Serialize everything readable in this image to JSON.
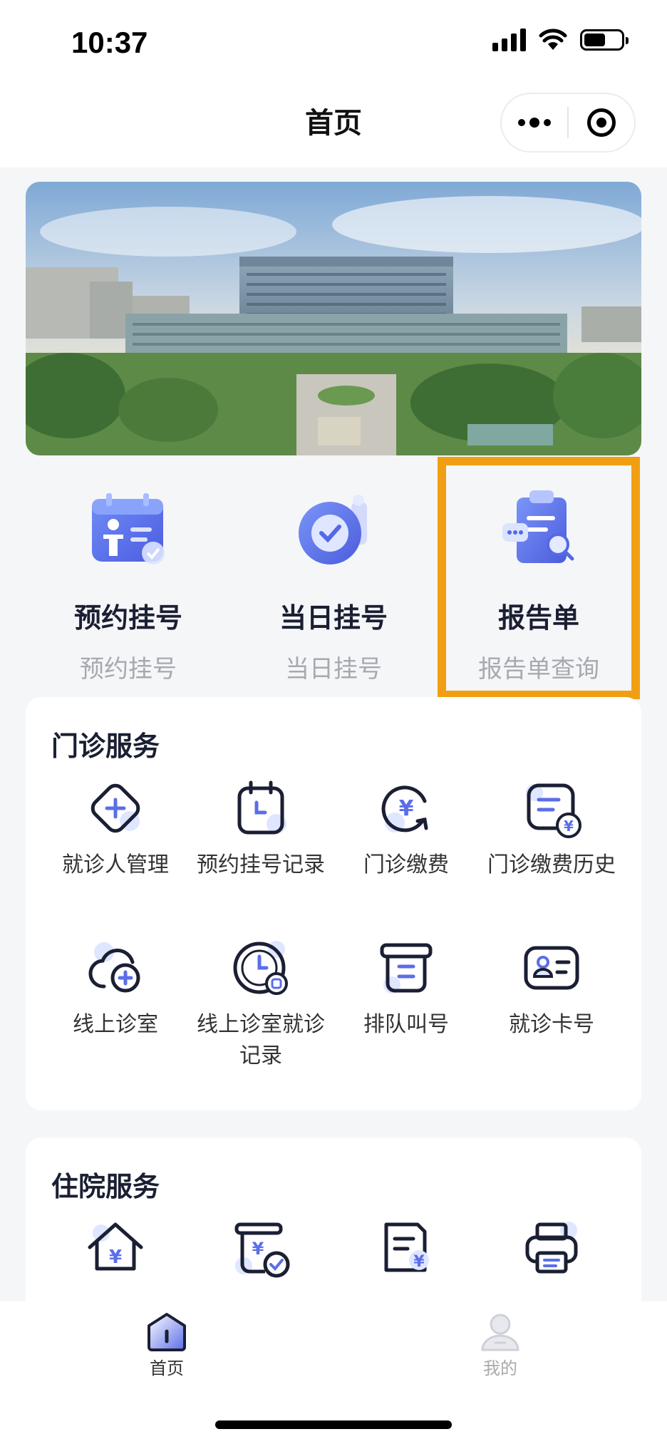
{
  "status_bar": {
    "time": "10:37"
  },
  "nav": {
    "title": "首页"
  },
  "quick_actions": [
    {
      "title": "预约挂号",
      "subtitle": "预约挂号",
      "icon": "calendar-person-icon"
    },
    {
      "title": "当日挂号",
      "subtitle": "当日挂号",
      "icon": "check-badge-icon"
    },
    {
      "title": "报告单",
      "subtitle": "报告单查询",
      "icon": "report-clipboard-icon"
    }
  ],
  "outpatient": {
    "title": "门诊服务",
    "items": [
      {
        "label": "就诊人管理",
        "icon": "plus-diamond-icon"
      },
      {
        "label": "预约挂号记录",
        "icon": "calendar-clock-icon"
      },
      {
        "label": "门诊缴费",
        "icon": "yuan-refresh-icon"
      },
      {
        "label": "门诊缴费历史",
        "icon": "bill-history-icon"
      },
      {
        "label": "线上诊室",
        "icon": "cloud-plus-icon"
      },
      {
        "label": "线上诊室就诊记录",
        "icon": "clock-record-icon"
      },
      {
        "label": "排队叫号",
        "icon": "queue-box-icon"
      },
      {
        "label": "就诊卡号",
        "icon": "id-card-icon"
      }
    ]
  },
  "inpatient": {
    "title": "住院服务",
    "items": [
      {
        "label": "",
        "icon": "house-yuan-icon"
      },
      {
        "label": "",
        "icon": "deposit-check-icon"
      },
      {
        "label": "",
        "icon": "document-yuan-icon"
      },
      {
        "label": "",
        "icon": "printer-icon"
      }
    ]
  },
  "tab_bar": {
    "items": [
      {
        "label": "首页",
        "icon": "home-icon",
        "active": true
      },
      {
        "label": "我的",
        "icon": "user-icon",
        "active": false
      }
    ]
  },
  "colors": {
    "accent": "#f19f12",
    "primary": "#1a1f33",
    "icon_blue": "#5b6ee8"
  }
}
